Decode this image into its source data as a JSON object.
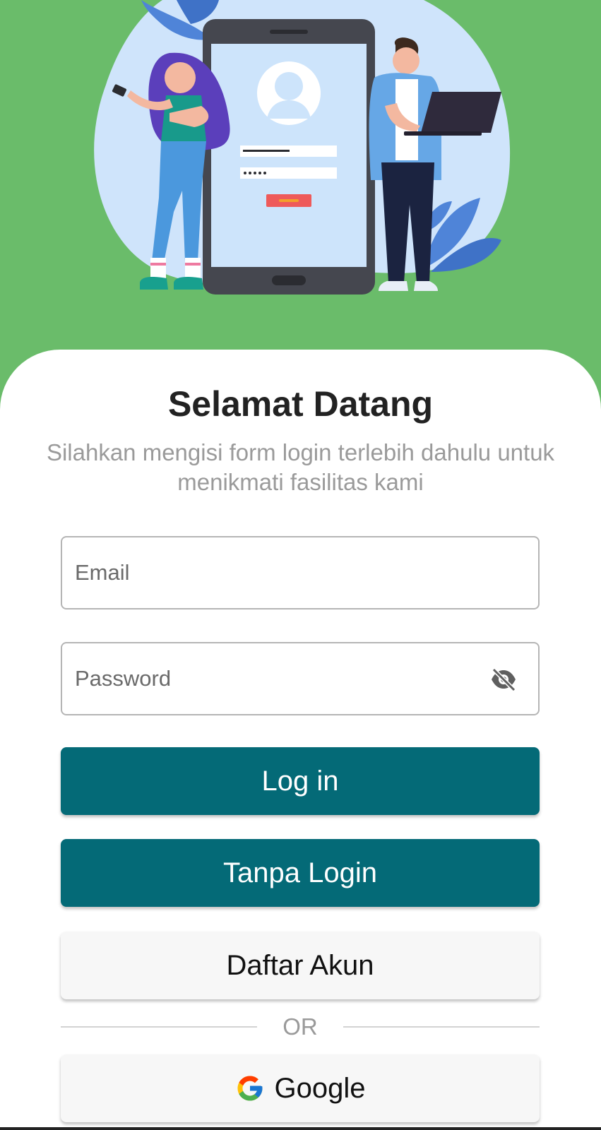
{
  "header": {
    "title": "Selamat Datang",
    "subtitle": "Silahkan mengisi form login terlebih dahulu untuk menikmati fasilitas kami"
  },
  "form": {
    "email_placeholder": "Email",
    "email_value": "",
    "password_placeholder": "Password",
    "password_value": ""
  },
  "buttons": {
    "login_label": "Log in",
    "guest_label": "Tanpa Login",
    "register_label": "Daftar Akun",
    "google_label": "Google"
  },
  "divider": {
    "label": "OR"
  },
  "icons": {
    "password_toggle": "eye-off-icon",
    "google": "google-icon"
  },
  "colors": {
    "header_bg": "#6abc6a",
    "primary": "#046a77",
    "secondary_bg": "#f7f7f7"
  }
}
